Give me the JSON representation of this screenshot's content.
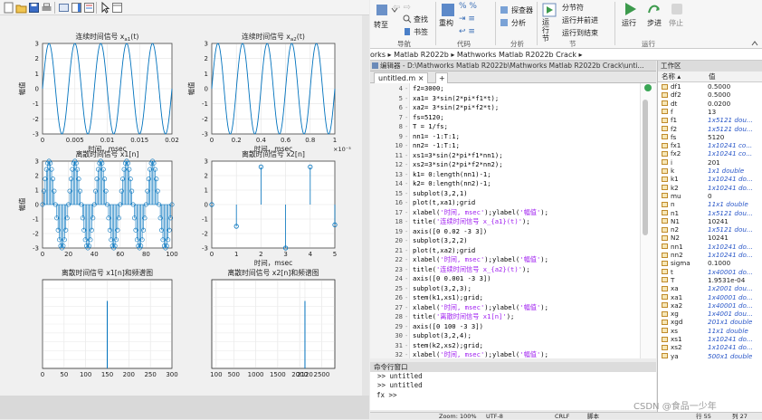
{
  "figure": {
    "plots": [
      {
        "title": "连续时间信号 x",
        "title_sub": "a1",
        "title_tail": "(t)",
        "ylabel": "幅值",
        "xlabel": "时间，msec",
        "xticks": [
          "0",
          "0.005",
          "0.01",
          "0.015",
          "0.02"
        ],
        "yticks": [
          "3",
          "2",
          "1",
          "0",
          "-1",
          "-2",
          "-3"
        ],
        "exponent": ""
      },
      {
        "title": "连续时间信号 x",
        "title_sub": "a2",
        "title_tail": "(t)",
        "ylabel": "幅值",
        "xlabel": "时间，msec",
        "xticks": [
          "0",
          "0.2",
          "0.4",
          "0.6",
          "0.8",
          "1"
        ],
        "yticks": [
          "3",
          "2",
          "1",
          "0",
          "-1",
          "-2",
          "-3"
        ],
        "exponent": "×10⁻³"
      },
      {
        "title": "离散时间信号 x1[n]",
        "ylabel": "幅值",
        "xlabel": "",
        "xticks": [
          "0",
          "20",
          "40",
          "60",
          "80",
          "100"
        ],
        "yticks": [
          "3",
          "2",
          "1",
          "0",
          "-1",
          "-2",
          "-3"
        ]
      },
      {
        "title": "离散时间信号 x2[n]",
        "ylabel": "",
        "xlabel": "时间，msec",
        "xticks": [
          "0",
          "1",
          "2",
          "3",
          "4",
          "5"
        ],
        "yticks": [
          "3",
          "2",
          "1",
          "0",
          "-1",
          "-2",
          "-3"
        ]
      },
      {
        "title": "离散时间信号 x1[n]和频谱图",
        "xticks": [
          "0",
          "50",
          "100",
          "150",
          "200",
          "250",
          "300"
        ]
      },
      {
        "title": "离散时间信号 x2[n]和频谱图",
        "xticks": [
          "100",
          "500",
          "1000",
          "1500",
          "2000",
          "2120",
          "2500"
        ]
      }
    ]
  },
  "chart_data": [
    {
      "type": "line",
      "x_range": [
        0,
        0.02
      ],
      "ylim": [
        -3,
        3
      ],
      "grid": true,
      "amplitude": 3,
      "frequency_per_x": 250,
      "color": "#0072bd"
    },
    {
      "type": "line",
      "x_range": [
        0,
        0.001
      ],
      "ylim": [
        -3,
        3
      ],
      "grid": true,
      "amplitude": 3,
      "frequency_per_x": 5000,
      "color": "#0072bd"
    },
    {
      "type": "stem",
      "x_range": [
        0,
        100
      ],
      "ylim": [
        -3,
        3
      ],
      "grid": true,
      "amplitude": 3,
      "samples": 101,
      "period": 20,
      "color": "#0072bd"
    },
    {
      "type": "stem",
      "x_range": [
        0,
        5
      ],
      "ylim": [
        -3,
        3
      ],
      "grid": true,
      "x": [
        0,
        1,
        2,
        3,
        4,
        5
      ],
      "y": [
        0,
        -1.5,
        2.6,
        -3,
        2.6,
        -1.4
      ],
      "color": "#0072bd"
    },
    {
      "type": "stem",
      "x_range": [
        0,
        300
      ],
      "grid": true,
      "x": [
        150
      ],
      "y": [
        1
      ],
      "color": "#0072bd"
    },
    {
      "type": "stem",
      "x_range": [
        0,
        2800
      ],
      "grid": true,
      "x": [
        2120
      ],
      "y": [
        1
      ],
      "color": "#0072bd"
    }
  ],
  "toolstrip": {
    "run_section_label": "转至",
    "find_label": "查找",
    "bookmark_label": "书签",
    "refactor_label": "重构",
    "profiler_label": "探查器",
    "analyze_label": "分析",
    "section_label": "分节符",
    "run_advance_label": "运行并前进",
    "run_end_label": "运行到结束",
    "run_label": "运行",
    "step_label": "步进",
    "stop_label": "停止",
    "section_run_label": "运行节",
    "groups": [
      "导航",
      "代码",
      "分析",
      "节",
      "运行"
    ]
  },
  "path": {
    "text": "orks  ▸  Matlab R2022b  ▸  Mathworks Matlab R2022b Crack  ▸"
  },
  "editor": {
    "title": "编辑器 - D:\\Mathworks Matlab R2022b\\Mathworks Matlab R2022b Crack\\unti...",
    "tab": "untitled.m",
    "add_tab": "+",
    "lines": [
      {
        "n": "4",
        "code": "f2=3000;"
      },
      {
        "n": "5",
        "code": "xa1= 3*sin(2*pi*f1*t);"
      },
      {
        "n": "6",
        "code": "xa2= 3*sin(2*pi*f2*t);"
      },
      {
        "n": "7",
        "code": "fs=5120;"
      },
      {
        "n": "8",
        "code": "T = 1/fs;"
      },
      {
        "n": "9",
        "code": "nn1= -1:T:1;"
      },
      {
        "n": "10",
        "code": "nn2= -1:T:1;"
      },
      {
        "n": "11",
        "code": "xs1=3*sin(2*pi*f1*nn1);"
      },
      {
        "n": "12",
        "code": "xs2=3*sin(2*pi*f2*nn2);"
      },
      {
        "n": "13",
        "code": "k1= 0:length(nn1)-1;"
      },
      {
        "n": "14",
        "code": "k2= 0:length(nn2)-1;"
      },
      {
        "n": "15",
        "code": "subplot(3,2,1)"
      },
      {
        "n": "16",
        "code": "plot(t,xa1);grid"
      },
      {
        "n": "17",
        "code": "xlabel('时间, msec');ylabel('幅值');"
      },
      {
        "n": "18",
        "code": "title('连续时间信号 x_{a1}(t)');"
      },
      {
        "n": "19",
        "code": "axis([0 0.02 -3 3])"
      },
      {
        "n": "20",
        "code": "subplot(3,2,2)"
      },
      {
        "n": "21",
        "code": "plot(t,xa2);grid"
      },
      {
        "n": "22",
        "code": "xlabel('时间, msec');ylabel('幅值');"
      },
      {
        "n": "23",
        "code": "title('连续时间信号 x_{a2}(t)');"
      },
      {
        "n": "24",
        "code": "axis([0 0.001 -3 3])"
      },
      {
        "n": "25",
        "code": "subplot(3,2,3);"
      },
      {
        "n": "26",
        "code": "stem(k1,xs1);grid;"
      },
      {
        "n": "27",
        "code": "xlabel('时间, msec');ylabel('幅值');"
      },
      {
        "n": "28",
        "code": "title('离散时间信号 x1[n]');"
      },
      {
        "n": "29",
        "code": "axis([0 100 -3 3])"
      },
      {
        "n": "30",
        "code": "subplot(3,2,4);"
      },
      {
        "n": "31",
        "code": "stem(k2,xs2);grid;"
      },
      {
        "n": "32",
        "code": "xlabel('时间, msec');ylabel('幅值');"
      }
    ]
  },
  "command_window": {
    "title": "命令行窗口",
    "lines": [
      ">> untitled",
      ">> untitled"
    ],
    "prompt": "fx >>"
  },
  "workspace": {
    "title": "工作区",
    "col_name": "名称 ▴",
    "col_value": "值",
    "vars": [
      {
        "name": "df1",
        "value": "0.5000",
        "italic": false
      },
      {
        "name": "df2",
        "value": "0.5000",
        "italic": false
      },
      {
        "name": "dt",
        "value": "0.0200",
        "italic": false
      },
      {
        "name": "f",
        "value": "13",
        "italic": false
      },
      {
        "name": "f1",
        "value": "1x5121 dou...",
        "italic": true
      },
      {
        "name": "f2",
        "value": "1x5121 dou...",
        "italic": true
      },
      {
        "name": "fs",
        "value": "5120",
        "italic": false
      },
      {
        "name": "fx1",
        "value": "1x10241 co...",
        "italic": true
      },
      {
        "name": "fx2",
        "value": "1x10241 co...",
        "italic": true
      },
      {
        "name": "i",
        "value": "201",
        "italic": false
      },
      {
        "name": "k",
        "value": "1x1 double",
        "italic": true
      },
      {
        "name": "k1",
        "value": "1x10241 do...",
        "italic": true
      },
      {
        "name": "k2",
        "value": "1x10241 do...",
        "italic": true
      },
      {
        "name": "mu",
        "value": "0",
        "italic": false
      },
      {
        "name": "n",
        "value": "11x1 double",
        "italic": true
      },
      {
        "name": "n1",
        "value": "1x5121 dou...",
        "italic": true
      },
      {
        "name": "N1",
        "value": "10241",
        "italic": false
      },
      {
        "name": "n2",
        "value": "1x5121 dou...",
        "italic": true
      },
      {
        "name": "N2",
        "value": "10241",
        "italic": false
      },
      {
        "name": "nn1",
        "value": "1x10241 do...",
        "italic": true
      },
      {
        "name": "nn2",
        "value": "1x10241 do...",
        "italic": true
      },
      {
        "name": "sigma",
        "value": "0.1000",
        "italic": false
      },
      {
        "name": "t",
        "value": "1x40001 do...",
        "italic": true
      },
      {
        "name": "T",
        "value": "1.9531e-04",
        "italic": false
      },
      {
        "name": "xa",
        "value": "1x2001 dou...",
        "italic": true
      },
      {
        "name": "xa1",
        "value": "1x40001 do...",
        "italic": true
      },
      {
        "name": "xa2",
        "value": "1x40001 do...",
        "italic": true
      },
      {
        "name": "xg",
        "value": "1x4001 dou...",
        "italic": true
      },
      {
        "name": "xgd",
        "value": "201x1 double",
        "italic": true
      },
      {
        "name": "xs",
        "value": "11x1 double",
        "italic": true
      },
      {
        "name": "xs1",
        "value": "1x10241 do...",
        "italic": true
      },
      {
        "name": "xs2",
        "value": "1x10241 do...",
        "italic": true
      },
      {
        "name": "ya",
        "value": "500x1 double",
        "italic": true
      }
    ]
  },
  "status": {
    "zoom": "Zoom: 100%",
    "encoding": "UTF-8",
    "eol": "CRLF",
    "type": "脚本",
    "row": "行  55",
    "col": "列  27"
  },
  "watermark": "CSDN @食品一少年"
}
